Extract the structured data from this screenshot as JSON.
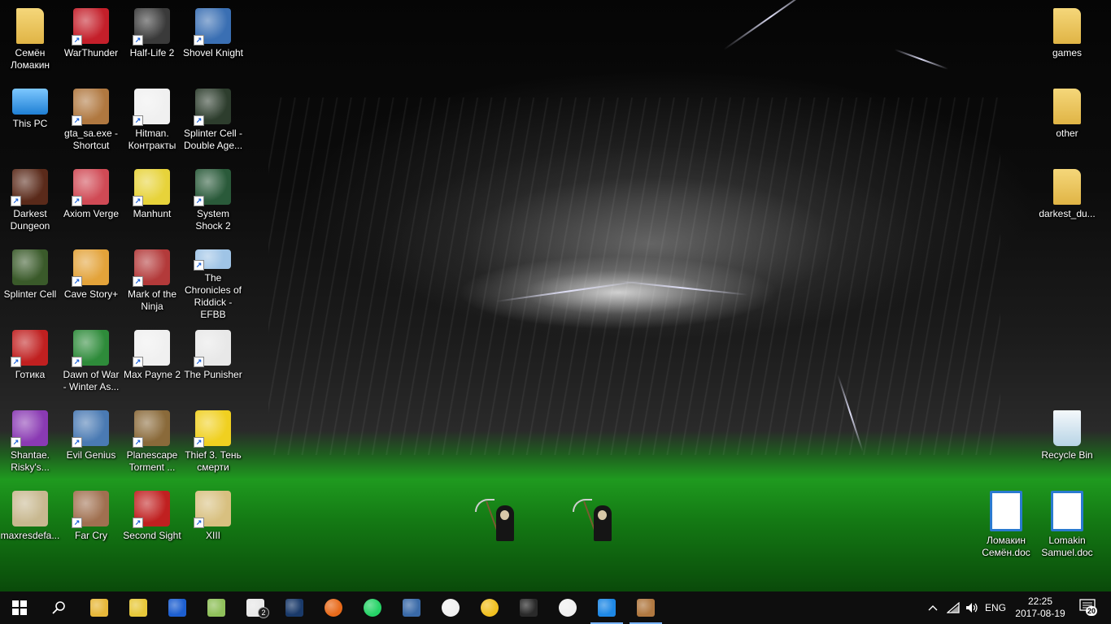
{
  "desktop": {
    "icons_left": [
      {
        "label": "Семён Ломакин",
        "icon": "user-folder-icon",
        "color": "#e7c05a",
        "shortcut": false
      },
      {
        "label": "WarThunder",
        "icon": "warthunder-icon",
        "color": "#c41f2a",
        "shortcut": true
      },
      {
        "label": "Half-Life 2",
        "icon": "half-life-2-icon",
        "color": "#3a3a3a",
        "shortcut": true
      },
      {
        "label": "Shovel Knight",
        "icon": "shovel-knight-icon",
        "color": "#3a6fb3",
        "shortcut": true
      },
      {
        "label": "This PC",
        "icon": "computer-icon",
        "color": "#3fa4e8",
        "shortcut": false
      },
      {
        "label": "gta_sa.exe - Shortcut",
        "icon": "gta-sa-icon",
        "color": "#b07840",
        "shortcut": true
      },
      {
        "label": "Hitman. Контракты",
        "icon": "hitman-icon",
        "color": "#f0f0f0",
        "shortcut": true
      },
      {
        "label": "Splinter Cell - Double Age...",
        "icon": "splinter-cell-double-agent-icon",
        "color": "#2d3d2d",
        "shortcut": true
      },
      {
        "label": "Darkest Dungeon",
        "icon": "darkest-dungeon-icon",
        "color": "#5a2a1a",
        "shortcut": true
      },
      {
        "label": "Axiom Verge",
        "icon": "axiom-verge-icon",
        "color": "#d04a55",
        "shortcut": true
      },
      {
        "label": "Manhunt",
        "icon": "manhunt-icon",
        "color": "#e7d33a",
        "shortcut": true
      },
      {
        "label": "System Shock 2",
        "icon": "system-shock-2-icon",
        "color": "#2a5a3a",
        "shortcut": true
      },
      {
        "label": "Splinter Cell",
        "icon": "splinter-cell-icon",
        "color": "#3a5a2a",
        "shortcut": false
      },
      {
        "label": "Cave Story+",
        "icon": "cave-story-icon",
        "color": "#e3a33a",
        "shortcut": true
      },
      {
        "label": "Mark of the Ninja",
        "icon": "mark-of-the-ninja-icon",
        "color": "#b33a3a",
        "shortcut": true
      },
      {
        "label": "The Chronicles of Riddick - EFBB",
        "icon": "riddick-icon",
        "color": "#9fc4e6",
        "shortcut": true
      },
      {
        "label": "Готика",
        "icon": "gothic-icon",
        "color": "#c02020",
        "shortcut": true
      },
      {
        "label": "Dawn of War - Winter As...",
        "icon": "dawn-of-war-icon",
        "color": "#2e8b3a",
        "shortcut": true
      },
      {
        "label": "Max Payne 2",
        "icon": "max-payne-2-icon",
        "color": "#f0f0f0",
        "shortcut": true
      },
      {
        "label": "The Punisher",
        "icon": "punisher-icon",
        "color": "#e8e8e8",
        "shortcut": true
      },
      {
        "label": "Shantae. Risky's...",
        "icon": "shantae-icon",
        "color": "#8a3ab3",
        "shortcut": true
      },
      {
        "label": "Evil Genius",
        "icon": "evil-genius-icon",
        "color": "#4a7ab3",
        "shortcut": true
      },
      {
        "label": "Planescape Torment ...",
        "icon": "planescape-torment-icon",
        "color": "#8a6a3a",
        "shortcut": true
      },
      {
        "label": "Thief 3. Тень смерти",
        "icon": "thief-3-icon",
        "color": "#f0d020",
        "shortcut": true
      },
      {
        "label": "maxresdefa...",
        "icon": "image-file-icon",
        "color": "#c8b890",
        "shortcut": false
      },
      {
        "label": "Far Cry",
        "icon": "far-cry-icon",
        "color": "#a07050",
        "shortcut": true
      },
      {
        "label": "Second Sight",
        "icon": "second-sight-icon",
        "color": "#c02020",
        "shortcut": true
      },
      {
        "label": "XIII",
        "icon": "xiii-icon",
        "color": "#d8c080",
        "shortcut": true
      }
    ],
    "icons_right": [
      {
        "label": "games",
        "icon": "folder-icon",
        "color": "#e7c05a"
      },
      {
        "label": "other",
        "icon": "folder-icon",
        "color": "#e7c05a"
      },
      {
        "label": "darkest_du...",
        "icon": "media-folder-icon",
        "color": "#e7c05a"
      },
      {
        "label": "Recycle Bin",
        "icon": "recycle-bin-icon",
        "color": "#d0e4f0"
      }
    ],
    "icons_docs": [
      {
        "label": "Ломакин Семён.doc",
        "icon": "writer-document-icon",
        "color": "#2a7ad0"
      },
      {
        "label": "Lomakin Samuel.doc",
        "icon": "writer-document-icon",
        "color": "#2a7ad0"
      }
    ]
  },
  "taskbar": {
    "apps": [
      {
        "name": "file-explorer",
        "icon": "folder-icon",
        "color": "#e7b83a",
        "active": false,
        "badge": ""
      },
      {
        "name": "winamp",
        "icon": "winamp-icon",
        "color": "#e7c83a",
        "active": false,
        "badge": ""
      },
      {
        "name": "calculator-app",
        "icon": "grid-app-icon",
        "color": "#1d5fd0",
        "active": false,
        "badge": ""
      },
      {
        "name": "notepad-app",
        "icon": "notepad-icon",
        "color": "#8fc05a",
        "active": false,
        "badge": ""
      },
      {
        "name": "mail",
        "icon": "mail-icon",
        "color": "#e8e8e8",
        "active": false,
        "badge": "2"
      },
      {
        "name": "photoshop",
        "icon": "photoshop-icon",
        "color": "#1a3a6a",
        "active": false,
        "badge": ""
      },
      {
        "name": "firefox",
        "icon": "firefox-icon",
        "color": "#e86a1a",
        "active": false,
        "badge": ""
      },
      {
        "name": "whatsapp",
        "icon": "whatsapp-icon",
        "color": "#25d366",
        "active": false,
        "badge": ""
      },
      {
        "name": "game-app",
        "icon": "game-app-icon",
        "color": "#3a6aa8",
        "active": false,
        "badge": ""
      },
      {
        "name": "brightness-app",
        "icon": "sun-icon",
        "color": "#f0f0f0",
        "active": false,
        "badge": ""
      },
      {
        "name": "player-app",
        "icon": "player-icon",
        "color": "#f0c020",
        "active": false,
        "badge": ""
      },
      {
        "name": "command-prompt",
        "icon": "terminal-icon",
        "color": "#2a2a2a",
        "active": false,
        "badge": ""
      },
      {
        "name": "messaging",
        "icon": "chat-icon",
        "color": "#f0f0f0",
        "active": false,
        "badge": ""
      },
      {
        "name": "edge",
        "icon": "edge-icon",
        "color": "#1e88e5",
        "active": true,
        "badge": ""
      },
      {
        "name": "gta-sa",
        "icon": "gta-sa-icon",
        "color": "#b07840",
        "active": true,
        "badge": ""
      }
    ],
    "tray": {
      "language": "ENG",
      "time": "22:25",
      "date": "2017-08-19",
      "notification_count": "20"
    }
  }
}
